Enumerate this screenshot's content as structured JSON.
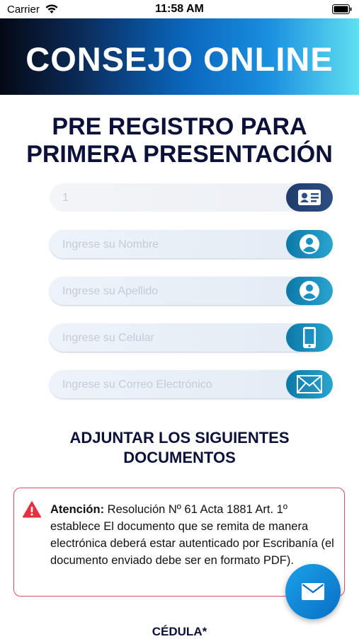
{
  "status_bar": {
    "carrier": "Carrier",
    "time": "11:58 AM"
  },
  "header": {
    "title": "CONSEJO ONLINE"
  },
  "page_title_line1": "PRE REGISTRO PARA",
  "page_title_line2": "PRIMERA PRESENTACIÓN",
  "form": {
    "id_field": {
      "value": "1",
      "icon": "id-card-icon"
    },
    "nombre": {
      "placeholder": "Ingrese su Nombre",
      "icon": "user-icon"
    },
    "apellido": {
      "placeholder": "Ingrese su Apellido",
      "icon": "user-icon"
    },
    "celular": {
      "placeholder": "Ingrese su Celular",
      "icon": "mobile-phone-icon"
    },
    "correo": {
      "placeholder": "Ingrese su Correo Electrónico",
      "icon": "envelope-icon"
    }
  },
  "section_title_line1": "ADJUNTAR LOS SIGUIENTES",
  "section_title_line2": "DOCUMENTOS",
  "alert": {
    "label": "Atención:",
    "message": " Resolución Nº 61 Acta 1881 Art. 1º establece El documento que se remita de manera electrónica deberá estar autenticado por Escribanía (el documento enviado debe ser en formato PDF)."
  },
  "document_label": "CÉDULA*",
  "fab": {
    "icon": "mail-icon"
  },
  "colors": {
    "accent": "#0c79a8",
    "title": "#0b1138",
    "alert_border": "#e0505a",
    "fab": "#0a6fc4"
  }
}
